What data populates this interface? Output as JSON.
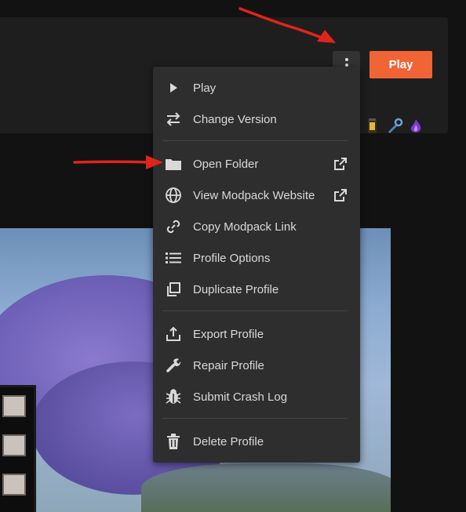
{
  "header": {
    "play_label": "Play",
    "mod_icons": [
      "lantern-icon",
      "wrench-icon",
      "purple-flame-icon"
    ]
  },
  "menu": {
    "items": [
      {
        "label": "Play",
        "icon": "play-icon"
      },
      {
        "label": "Change Version",
        "icon": "swap-arrows-icon"
      },
      {
        "label": "Open Folder",
        "icon": "folder-icon",
        "external": true
      },
      {
        "label": "View Modpack Website",
        "icon": "globe-icon",
        "external": true
      },
      {
        "label": "Copy Modpack Link",
        "icon": "link-icon"
      },
      {
        "label": "Profile Options",
        "icon": "list-icon"
      },
      {
        "label": "Duplicate Profile",
        "icon": "duplicate-icon"
      },
      {
        "label": "Export Profile",
        "icon": "export-icon"
      },
      {
        "label": "Repair Profile",
        "icon": "wrench-icon"
      },
      {
        "label": "Submit Crash Log",
        "icon": "bug-icon"
      },
      {
        "label": "Delete Profile",
        "icon": "trash-icon"
      }
    ]
  },
  "colors": {
    "accent": "#f16436",
    "menu_bg": "#2e2e2e",
    "page_bg": "#121212",
    "annotation": "#e0241b"
  }
}
